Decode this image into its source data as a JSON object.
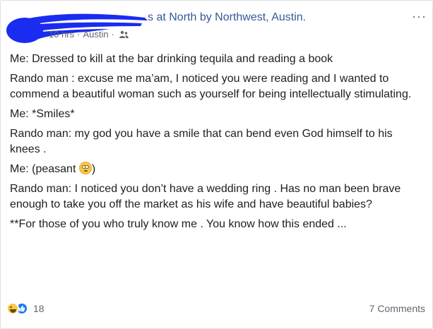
{
  "post": {
    "header": {
      "name_suffix": "s",
      "location_text": "at North by Northwest, Austin.",
      "time": "10 hrs",
      "separator": "·",
      "place": "Austin",
      "more_label": "···"
    },
    "paragraphs": [
      "Me: Dressed to kill at the bar drinking tequila and reading a book",
      "Rando man : excuse me ma’am, I noticed you were reading and I wanted to commend a beautiful woman such as yourself for being intellectually stimulating.",
      "Me: *Smiles*",
      "Rando man: my god you have a smile that can bend even God himself to his knees .",
      "Rando man: I noticed you don’t have a wedding ring . Has no man been brave enough to take you off the market as his wife and have beautiful babies?",
      "**For those of you who truly know me . You know how this ended ..."
    ],
    "peasant_line": {
      "prefix": "Me: (peasant ",
      "emoji": "eye-roll-emoji",
      "suffix": ")"
    },
    "footer": {
      "reaction_count": "18",
      "comments_label": "7 Comments"
    },
    "colors": {
      "link": "#365899",
      "text": "#1c1e21",
      "meta": "#616770",
      "redaction": "#1a2cf0",
      "like_blue": "#1877f2"
    }
  }
}
